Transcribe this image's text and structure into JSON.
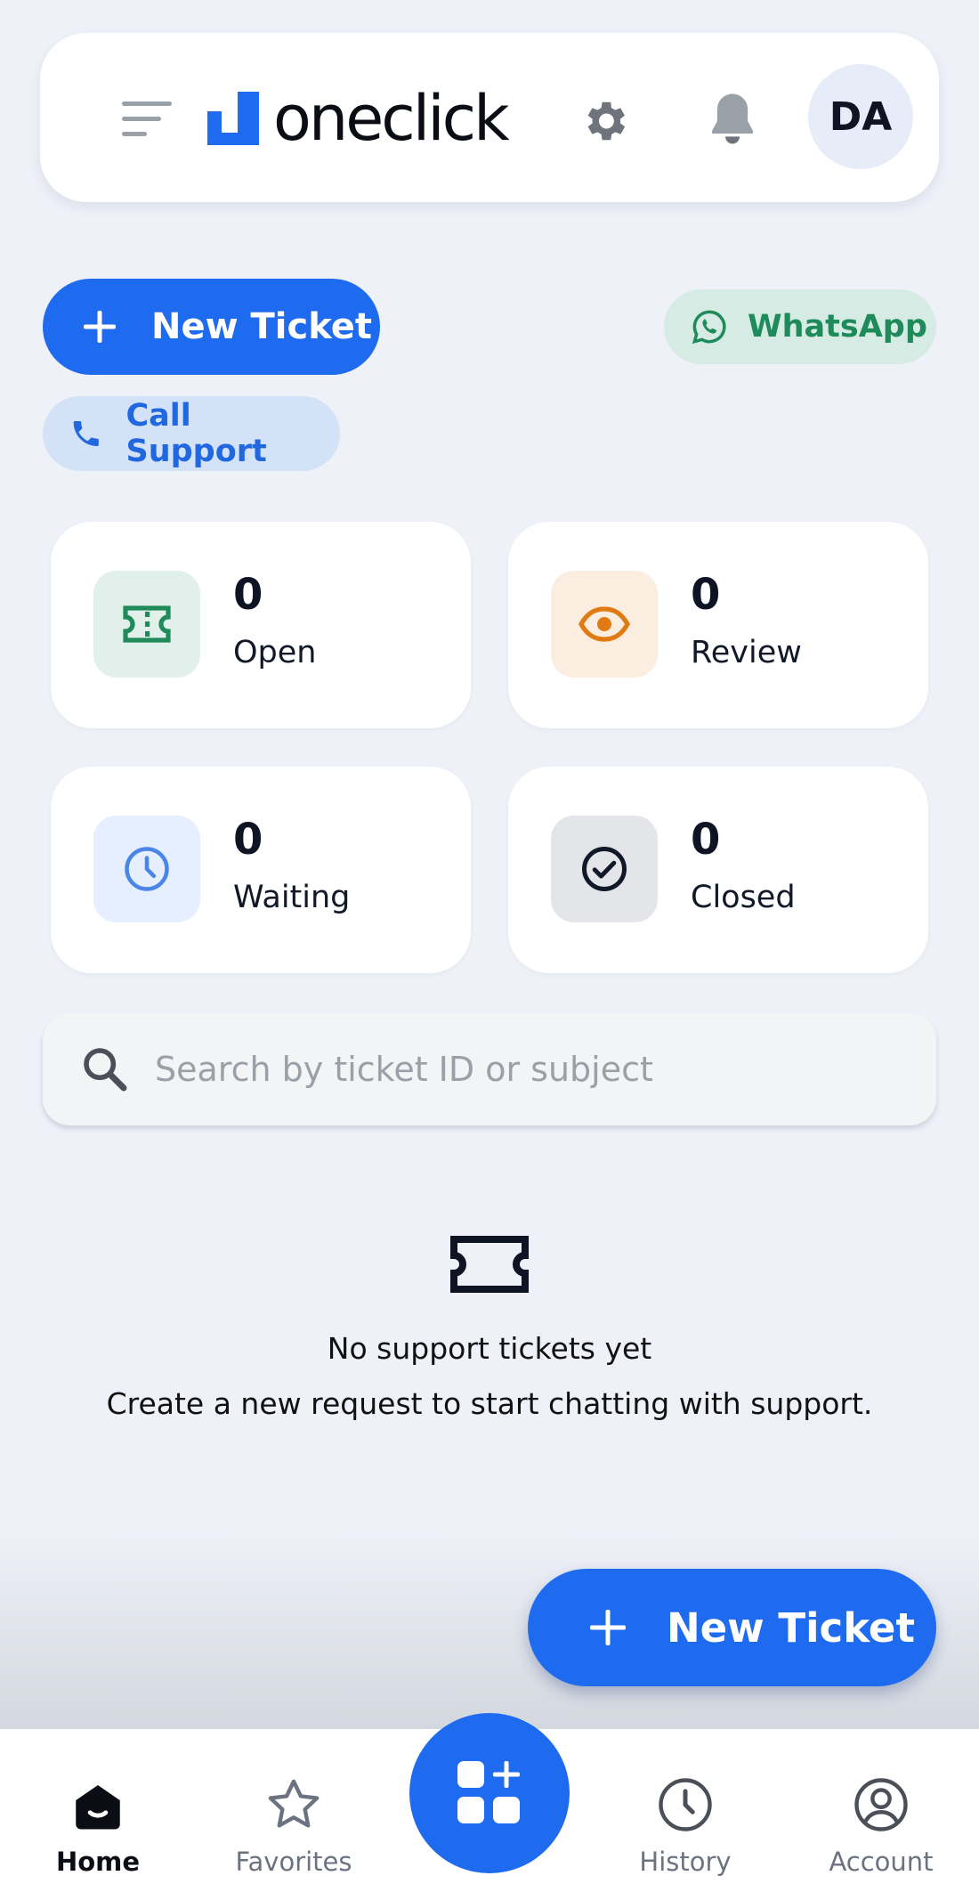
{
  "app": {
    "name": "oneclick",
    "user_initials": "DA"
  },
  "header": {
    "icons": [
      "menu-icon",
      "gear-icon",
      "bell-icon"
    ]
  },
  "actions": {
    "new_ticket_label": "New Ticket",
    "whatsapp_label": "WhatsApp",
    "call_support_label": "Call Support"
  },
  "stats": [
    {
      "count": "0",
      "label": "Open",
      "icon": "ticket-icon",
      "bg": "#e2f0ec",
      "color": "#1f8a5a"
    },
    {
      "count": "0",
      "label": "Review",
      "icon": "eye-icon",
      "bg": "#fbeee0",
      "color": "#e07b14"
    },
    {
      "count": "0",
      "label": "Waiting",
      "icon": "clock-icon",
      "bg": "#e6efff",
      "color": "#4a86e8"
    },
    {
      "count": "0",
      "label": "Closed",
      "icon": "check-circle-icon",
      "bg": "#e3e5e8",
      "color": "#111827"
    }
  ],
  "search": {
    "placeholder": "Search by ticket ID or subject",
    "value": ""
  },
  "empty_state": {
    "title": "No support tickets yet",
    "subtitle": "Create a new request to start chatting with support."
  },
  "fab": {
    "label": "New Ticket"
  },
  "bottom_nav": {
    "items": [
      {
        "label": "Home",
        "icon": "home-icon",
        "active": true
      },
      {
        "label": "Favorites",
        "icon": "star-icon",
        "active": false
      },
      {
        "label": "History",
        "icon": "clock-icon",
        "active": false
      },
      {
        "label": "Account",
        "icon": "account-icon",
        "active": false
      }
    ],
    "center_icon": "apps-add-icon"
  },
  "colors": {
    "primary": "#1f6bf0",
    "background": "#eef1f8",
    "whatsapp": "#1f8a5a"
  }
}
